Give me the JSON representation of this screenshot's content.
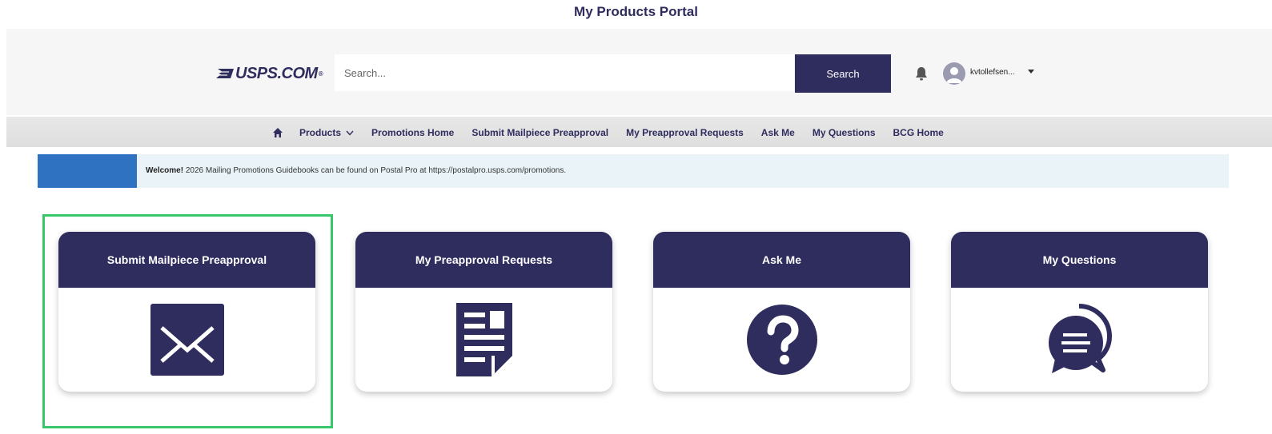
{
  "page": {
    "title": "My Products Portal"
  },
  "header": {
    "logo_text": "USPS.COM",
    "search_placeholder": "Search...",
    "search_button": "Search",
    "username": "kvtollefsen..."
  },
  "nav": {
    "items": [
      {
        "label": "Products"
      },
      {
        "label": "Promotions Home"
      },
      {
        "label": "Submit Mailpiece Preapproval"
      },
      {
        "label": "My Preapproval Requests"
      },
      {
        "label": "Ask Me"
      },
      {
        "label": "My Questions"
      },
      {
        "label": "BCG Home"
      }
    ]
  },
  "notice": {
    "bold": "Welcome!",
    "text": " 2026 Mailing Promotions Guidebooks can be found on Postal Pro at https://postalpro.usps.com/promotions."
  },
  "cards": [
    {
      "title": "Submit Mailpiece Preapproval",
      "icon": "envelope-icon"
    },
    {
      "title": "My Preapproval Requests",
      "icon": "document-icon"
    },
    {
      "title": "Ask Me",
      "icon": "question-icon"
    },
    {
      "title": "My Questions",
      "icon": "chat-bubbles-icon"
    }
  ],
  "colors": {
    "brand_navy": "#2f2c5e",
    "notice_blue": "#2f72c2",
    "notice_bg": "#eaf4f8",
    "highlight_green": "#38c86a"
  }
}
